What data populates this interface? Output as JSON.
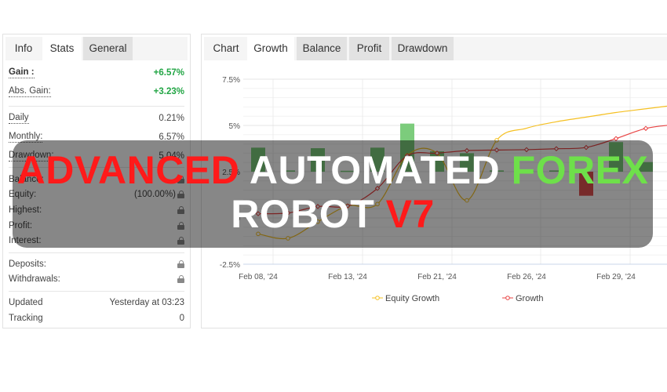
{
  "left_panel": {
    "tabs": [
      {
        "label": "Info"
      },
      {
        "label": "Stats",
        "active": true
      },
      {
        "label": "General"
      }
    ],
    "gain": {
      "label": "Gain :",
      "value": "+6.57%"
    },
    "abs_gain": {
      "label": "Abs. Gain:",
      "value": "+3.23%"
    },
    "daily": {
      "label": "Daily",
      "value": "0.21%"
    },
    "monthly": {
      "label": "Monthly:",
      "value": "6.57%"
    },
    "drawdown": {
      "label": "Drawdown:",
      "value": "5.04%"
    },
    "balance": {
      "label": "Balance:"
    },
    "equity": {
      "label": "Equity:",
      "value": "(100.00%)"
    },
    "highest": {
      "label": "Highest:"
    },
    "profit": {
      "label": "Profit:"
    },
    "interest": {
      "label": "Interest:"
    },
    "deposits": {
      "label": "Deposits:"
    },
    "withdrawals": {
      "label": "Withdrawals:"
    },
    "updated": {
      "label": "Updated",
      "value": "Yesterday at 03:23"
    },
    "tracking": {
      "label": "Tracking",
      "value": "0"
    }
  },
  "right_panel": {
    "tabs": [
      {
        "label": "Chart"
      },
      {
        "label": "Growth",
        "active": true
      },
      {
        "label": "Balance"
      },
      {
        "label": "Profit"
      },
      {
        "label": "Drawdown"
      }
    ]
  },
  "overlay": {
    "word1": "ADVANCED",
    "word2": "AUTOMATED",
    "word3": "FOREX",
    "word4": "ROBOT",
    "word5": "V7"
  },
  "colors": {
    "gain_green": "#21a544",
    "equity_line": "#f5c022",
    "growth_line": "#e84343",
    "bar_positive": "#7ccc7c",
    "bar_negative": "#e05050"
  },
  "chart_data": {
    "type": "line",
    "y_ticks": [
      "7.5%",
      "5%",
      "2.5%",
      "0",
      "-2.5%"
    ],
    "ylim": [
      -2.5,
      7.5
    ],
    "x_tick_labels": [
      "Feb 08, '24",
      "Feb 13, '24",
      "Feb 21, '24",
      "Feb 26, '24",
      "Feb 29, '24"
    ],
    "x_tick_indices": [
      0,
      3,
      6,
      9,
      12
    ],
    "grid": true,
    "legend_position": "bottom",
    "series": [
      {
        "name": "Equity Growth",
        "values": [
          -0.86,
          -1.1,
          -0.2,
          0.65,
          0.75,
          3.38,
          3.5,
          0.95,
          4.2,
          4.85,
          5.2,
          5.45,
          5.7,
          5.9,
          6.1
        ]
      },
      {
        "name": "Growth",
        "values": [
          0.23,
          0.27,
          0.62,
          0.65,
          1.6,
          3.36,
          3.5,
          3.64,
          3.67,
          3.69,
          3.74,
          3.81,
          4.29,
          4.84,
          5.05
        ]
      }
    ],
    "bars": {
      "baseline": 2.5,
      "values": [
        1.3,
        0.07,
        1.27,
        0.05,
        1.3,
        2.6,
        1.1,
        1.0,
        0.07,
        0.07,
        0.07,
        -1.3,
        1.6,
        0.52
      ]
    }
  }
}
